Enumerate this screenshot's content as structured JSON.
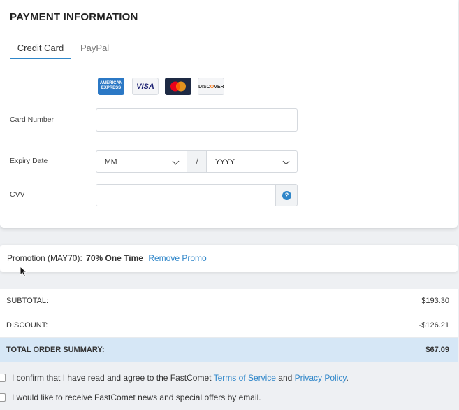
{
  "payment": {
    "title": "PAYMENT INFORMATION",
    "tabs": [
      {
        "label": "Credit Card",
        "active": true
      },
      {
        "label": "PayPal",
        "active": false
      }
    ],
    "card_logos": [
      {
        "name": "amex",
        "label": "AMERICAN EXPRESS"
      },
      {
        "name": "visa",
        "label": "VISA"
      },
      {
        "name": "mastercard",
        "label": ""
      },
      {
        "name": "discover",
        "label": "DISCOVER"
      }
    ],
    "fields": {
      "card_number_label": "Card Number",
      "card_number_value": "",
      "expiry_label": "Expiry Date",
      "expiry_month": "MM",
      "expiry_separator": "/",
      "expiry_year": "YYYY",
      "cvv_label": "CVV",
      "cvv_value": "",
      "help_glyph": "?"
    }
  },
  "promo": {
    "label": "Promotion (MAY70):",
    "value": "70% One Time",
    "remove_label": "Remove Promo"
  },
  "summary": {
    "subtotal_label": "SUBTOTAL:",
    "subtotal_value": "$193.30",
    "discount_label": "DISCOUNT:",
    "discount_value": "-$126.21",
    "total_label": "TOTAL ORDER SUMMARY:",
    "total_value": "$67.09"
  },
  "agreements": {
    "terms_prefix": "I confirm that I have read and agree to the FastComet ",
    "terms_link": "Terms of Service",
    "terms_and": " and ",
    "privacy_link": "Privacy Policy",
    "terms_suffix": ".",
    "newsletter": "I would like to receive FastComet news and special offers by email."
  },
  "colors": {
    "accent": "#2f86c9",
    "total_row_bg": "#d6e7f6",
    "page_bg": "#eef0f3"
  }
}
